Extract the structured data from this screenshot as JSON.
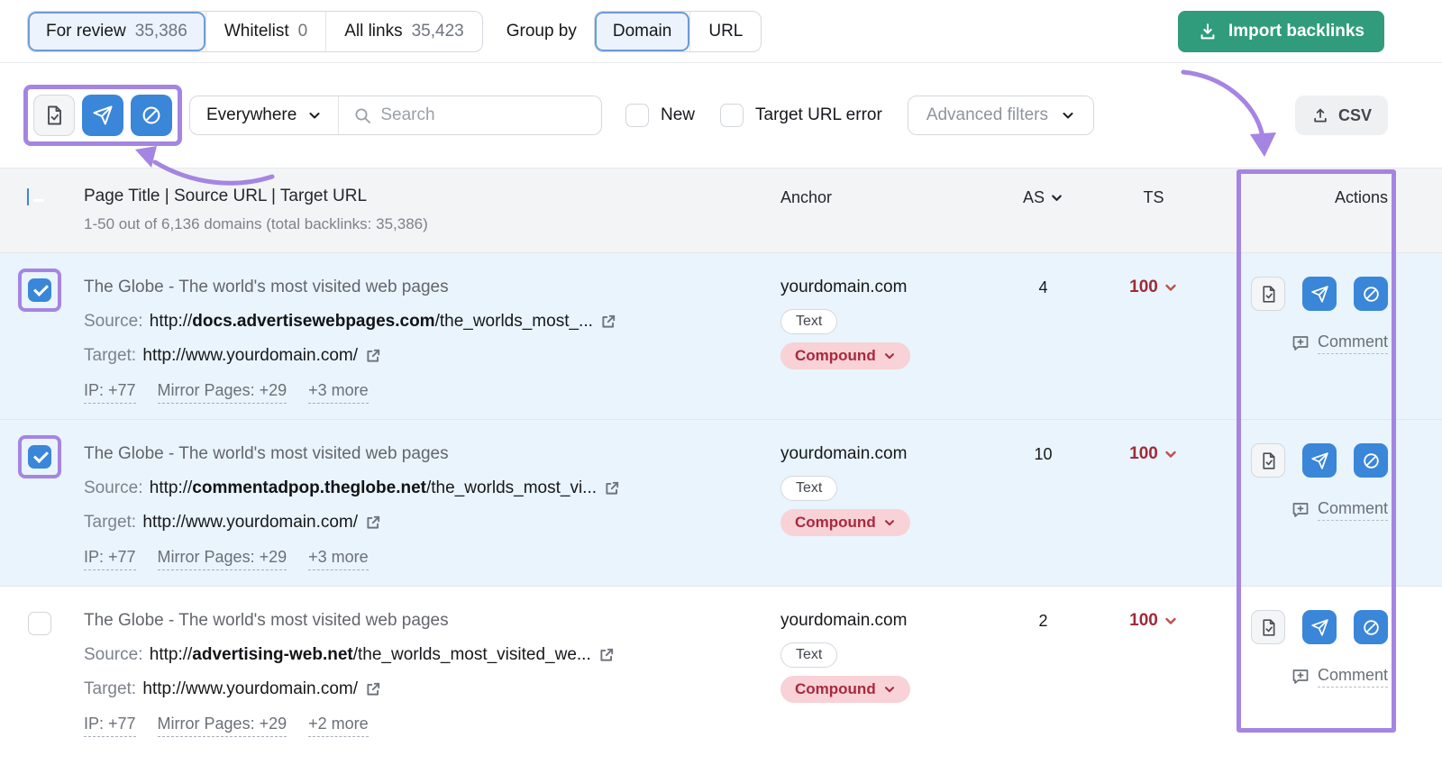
{
  "topbar": {
    "tabs": [
      {
        "label": "For review",
        "count": "35,386",
        "active": true
      },
      {
        "label": "Whitelist",
        "count": "0",
        "active": false
      },
      {
        "label": "All links",
        "count": "35,423",
        "active": false
      }
    ],
    "group_by_label": "Group by",
    "group_options": [
      {
        "label": "Domain",
        "active": true
      },
      {
        "label": "URL",
        "active": false
      }
    ],
    "import_label": "Import backlinks"
  },
  "toolbar": {
    "bulk_action_icons": [
      "document-check",
      "paper-plane",
      "block-circle"
    ],
    "scope_value": "Everywhere",
    "search_placeholder": "Search",
    "filters": [
      {
        "label": "New",
        "checked": false
      },
      {
        "label": "Target URL error",
        "checked": false
      }
    ],
    "advanced_filters_label": "Advanced filters",
    "csv_label": "CSV"
  },
  "table": {
    "header": {
      "main_title": "Page Title | Source URL | Target URL",
      "main_subtitle": "1-50 out of 6,136 domains (total backlinks: 35,386)",
      "col_anchor": "Anchor",
      "col_as": "AS",
      "col_ts": "TS",
      "col_actions": "Actions"
    },
    "rows": [
      {
        "selected": true,
        "checked": true,
        "checkbox_highlighted": true,
        "title": "The Globe - The world's most visited web pages",
        "source_label": "Source:",
        "source_protocol": "http://",
        "source_domain": "docs.advertisewebpages.com",
        "source_path": "/the_worlds_most_...",
        "target_label": "Target:",
        "target_url": "http://www.yourdomain.com/",
        "meta": [
          "IP: +77",
          "Mirror Pages: +29",
          "+3 more"
        ],
        "anchor": "yourdomain.com",
        "anchor_type_badge": "Text",
        "link_attribute_badge": "Compound",
        "as_score": "4",
        "ts_score": "100",
        "comment_label": "Comment"
      },
      {
        "selected": true,
        "checked": true,
        "checkbox_highlighted": true,
        "title": "The Globe - The world's most visited web pages",
        "source_label": "Source:",
        "source_protocol": "http://",
        "source_domain": "commentadpop.theglobe.net",
        "source_path": "/the_worlds_most_vi...",
        "target_label": "Target:",
        "target_url": "http://www.yourdomain.com/",
        "meta": [
          "IP: +77",
          "Mirror Pages: +29",
          "+3 more"
        ],
        "anchor": "yourdomain.com",
        "anchor_type_badge": "Text",
        "link_attribute_badge": "Compound",
        "as_score": "10",
        "ts_score": "100",
        "comment_label": "Comment"
      },
      {
        "selected": false,
        "checked": false,
        "checkbox_highlighted": false,
        "title": "The Globe - The world's most visited web pages",
        "source_label": "Source:",
        "source_protocol": "http://",
        "source_domain": "advertising-web.net",
        "source_path": "/the_worlds_most_visited_we...",
        "target_label": "Target:",
        "target_url": "http://www.yourdomain.com/",
        "meta": [
          "IP: +77",
          "Mirror Pages: +29",
          "+2 more"
        ],
        "anchor": "yourdomain.com",
        "anchor_type_badge": "Text",
        "link_attribute_badge": "Compound",
        "as_score": "2",
        "ts_score": "100",
        "comment_label": "Comment"
      }
    ]
  },
  "icons": {
    "import": "download-arrow-tray",
    "csv": "upload-arrow-tray",
    "search": "magnifier",
    "chevron": "chevron-down",
    "external_link": "arrow-out-of-box",
    "comment": "speech-bubble-plus",
    "whitelist": "document-check",
    "disavow": "paper-plane",
    "block": "block-circle"
  },
  "colors": {
    "accent_blue": "#3a86d8",
    "brand_green": "#319c7b",
    "annotation_purple": "#a585e2",
    "ts_red": "#9e2b39",
    "compound_pink": "#f8d2d6",
    "selected_row_blue": "#e9f4fc"
  }
}
